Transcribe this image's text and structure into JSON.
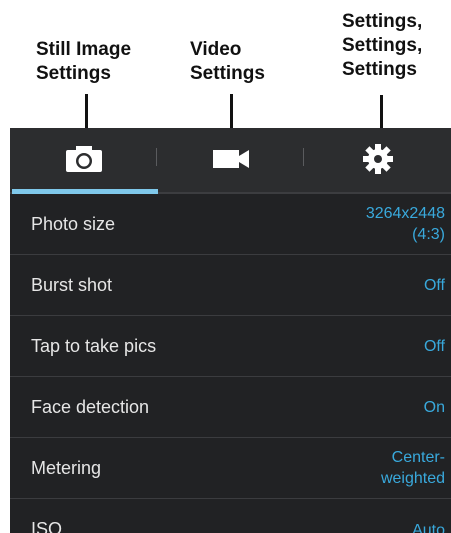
{
  "callouts": {
    "still": "Still Image\nSettings",
    "video": "Video\nSettings",
    "settings": "Settings,\nSettings,\nSettings"
  },
  "tabs": [
    {
      "icon": "camera-icon",
      "active": true
    },
    {
      "icon": "video-camera-icon",
      "active": false
    },
    {
      "icon": "gear-icon",
      "active": false
    }
  ],
  "colors": {
    "accent": "#39a9dc",
    "underline": "#7fc8ea",
    "tabbar": "#2c2d2f",
    "list_bg": "#212224",
    "label_text": "#e6e6e6"
  },
  "settings": [
    {
      "label": "Photo size",
      "value": "3264x2448\n(4:3)"
    },
    {
      "label": "Burst shot",
      "value": "Off"
    },
    {
      "label": "Tap to take pics",
      "value": "Off"
    },
    {
      "label": "Face detection",
      "value": "On"
    },
    {
      "label": "Metering",
      "value": "Center-\nweighted"
    },
    {
      "label": "ISO",
      "value": "Auto"
    }
  ]
}
